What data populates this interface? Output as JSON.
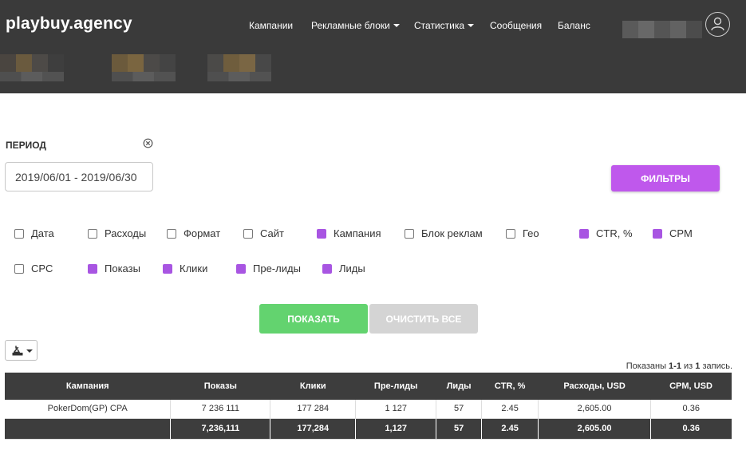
{
  "app": {
    "logo": "playbuy.agency"
  },
  "nav": {
    "items": [
      {
        "label": "Кампании",
        "dropdown": false
      },
      {
        "label": "Рекламные блоки",
        "dropdown": true
      },
      {
        "label": "Статистика",
        "dropdown": true
      },
      {
        "label": "Сообщения",
        "dropdown": false
      },
      {
        "label": "Баланс",
        "dropdown": false
      }
    ],
    "user_icon": "user-icon"
  },
  "filters": {
    "period_label": "ПЕРИОД",
    "date_value": "2019/06/01 - 2019/06/30",
    "filters_button": "ФИЛЬТРЫ",
    "checkboxes": [
      {
        "label": "Дата",
        "checked": false
      },
      {
        "label": "Расходы",
        "checked": false
      },
      {
        "label": "Формат",
        "checked": false
      },
      {
        "label": "Сайт",
        "checked": false
      },
      {
        "label": "Кампания",
        "checked": true
      },
      {
        "label": "Блок реклам",
        "checked": false
      },
      {
        "label": "Гео",
        "checked": false
      },
      {
        "label": "CTR, %",
        "checked": true
      },
      {
        "label": "CPM",
        "checked": true
      },
      {
        "label": "CPC",
        "checked": false
      },
      {
        "label": "Показы",
        "checked": true
      },
      {
        "label": "Клики",
        "checked": true
      },
      {
        "label": "Пре-лиды",
        "checked": true
      },
      {
        "label": "Лиды",
        "checked": true
      }
    ],
    "show_button": "ПОКАЗАТЬ",
    "clear_button": "ОЧИСТИТЬ ВСЕ"
  },
  "colors": {
    "header_bg": "#3a3a3a",
    "accent": "#bf58ec",
    "show": "#63d36f",
    "clear": "#d4d4d4"
  },
  "records": {
    "prefix": "Показаны ",
    "range": "1-1",
    "mid": " из ",
    "total": "1",
    "suffix": " запись."
  },
  "table": {
    "headers": [
      "Кампания",
      "Показы",
      "Клики",
      "Пре-лиды",
      "Лиды",
      "CTR, %",
      "Расходы, USD",
      "CPM, USD"
    ],
    "rows": [
      [
        "PokerDom(GP) CPA",
        "7 236 111",
        "177 284",
        "1 127",
        "57",
        "2.45",
        "2,605.00",
        "0.36"
      ]
    ],
    "totals": [
      "",
      "7,236,111",
      "177,284",
      "1,127",
      "57",
      "2.45",
      "2,605.00",
      "0.36"
    ]
  }
}
